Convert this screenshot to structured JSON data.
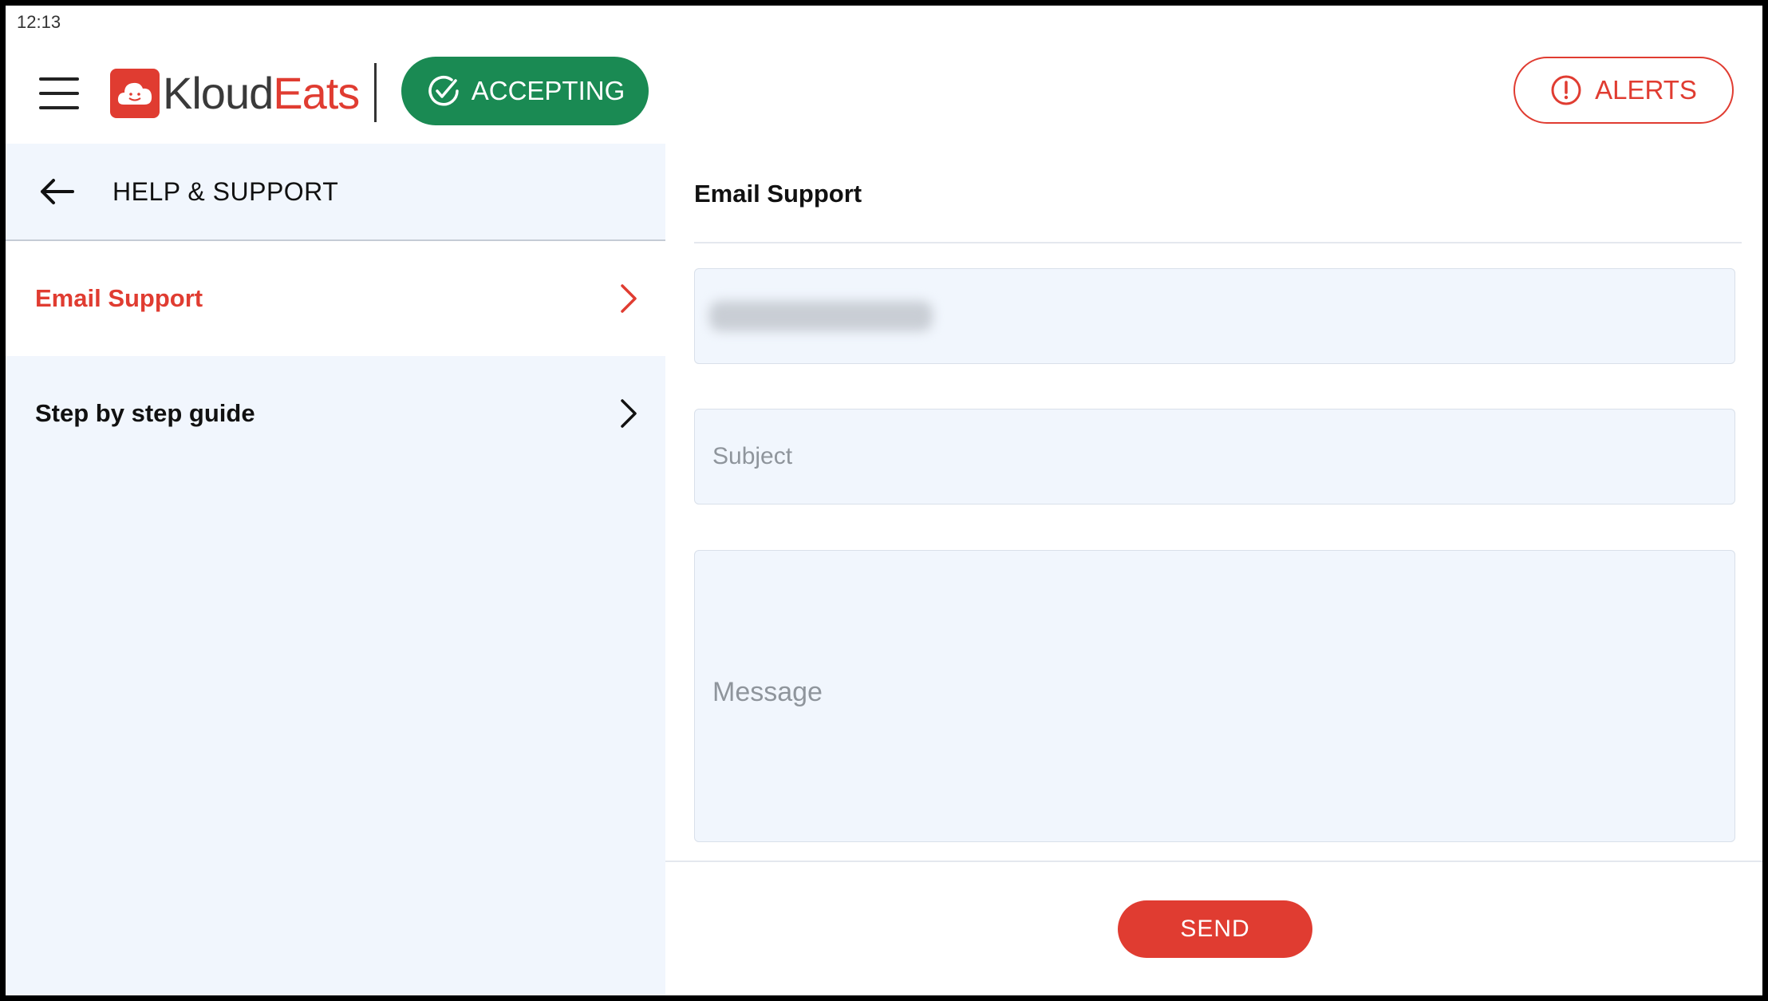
{
  "status_bar": {
    "time": "12:13"
  },
  "header": {
    "menu_icon": "hamburger-menu-icon",
    "logo": {
      "part1": "Kloud",
      "part2": "Eats",
      "icon": "cloud-smile-icon"
    },
    "accepting": {
      "label": "ACCEPTING",
      "icon": "check-circle-icon",
      "color": "#1a8a53"
    },
    "alerts": {
      "label": "ALERTS",
      "icon": "exclamation-circle-icon",
      "color": "#e03c31"
    }
  },
  "sidebar": {
    "title": "HELP & SUPPORT",
    "back_icon": "arrow-left-icon",
    "items": [
      {
        "label": "Email Support",
        "active": true,
        "icon": "chevron-right-icon"
      },
      {
        "label": "Step by step guide",
        "active": false,
        "icon": "chevron-right-icon"
      }
    ]
  },
  "main": {
    "title": "Email Support",
    "email": {
      "value": ""
    },
    "subject": {
      "placeholder": "Subject",
      "value": ""
    },
    "message": {
      "placeholder": "Message",
      "value": ""
    },
    "send_label": "SEND"
  },
  "colors": {
    "accent": "#e03c31",
    "sidebar_bg": "#f1f6fd",
    "accepting_green": "#1a8a53"
  }
}
